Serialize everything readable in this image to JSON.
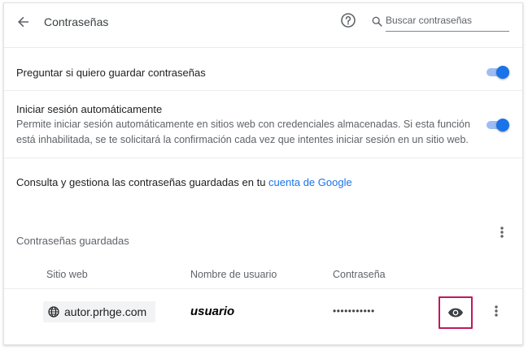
{
  "header": {
    "title": "Contraseñas",
    "back_icon": "arrow-back-icon",
    "help_icon": "help-circle-icon",
    "search_placeholder": "Buscar contraseñas"
  },
  "settings": {
    "offer_to_save": {
      "label": "Preguntar si quiero guardar contraseñas",
      "enabled": true
    },
    "auto_signin": {
      "label": "Iniciar sesión automáticamente",
      "description": "Permite iniciar sesión automáticamente en sitios web con credenciales almacenadas. Si esta función está inhabilitada, se te solicitará la confirmación cada vez que intentes iniciar sesión en un sitio web.",
      "enabled": true
    },
    "manage_text": "Consulta y gestiona las contraseñas guardadas en tu ",
    "manage_link": "cuenta de Google"
  },
  "saved": {
    "title": "Contraseñas guardadas",
    "columns": [
      "Sitio web",
      "Nombre de usuario",
      "Contraseña"
    ],
    "rows": [
      {
        "site": "autor.prhge.com",
        "username": "usuario",
        "password": "•••••••••••"
      }
    ]
  },
  "colors": {
    "accent": "#1a73e8",
    "toggle_track": "#9dbcf4",
    "highlight": "#c2185b"
  }
}
